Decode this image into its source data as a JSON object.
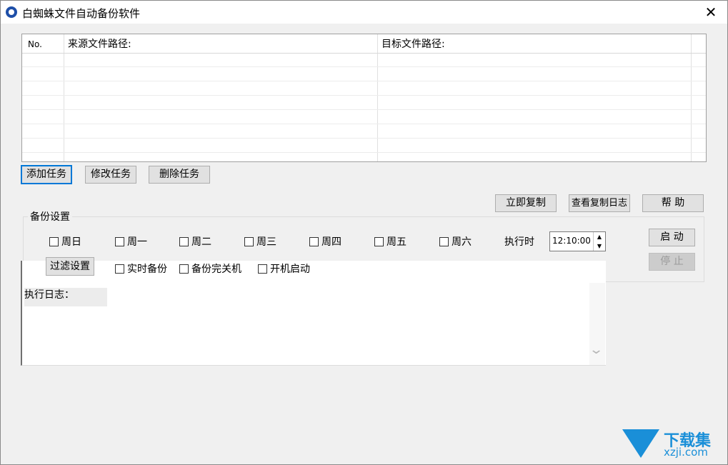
{
  "window": {
    "title": "白蜘蛛文件自动备份软件",
    "close": "✕"
  },
  "grid": {
    "columns": [
      "No.",
      "来源文件路径:",
      "目标文件路径:"
    ]
  },
  "task_buttons": {
    "add": "添加任务",
    "edit": "修改任务",
    "delete": "删除任务"
  },
  "action_buttons": {
    "copy_now": "立即复制",
    "view_log": "查看复制日志",
    "help": "帮 助"
  },
  "backup": {
    "title": "备份设置",
    "days": [
      "周日",
      "周一",
      "周二",
      "周三",
      "周四",
      "周五",
      "周六"
    ],
    "exec_time_label": "执行时",
    "exec_time_value": "12:10:00",
    "filter_button": "过滤设置",
    "options": [
      "实时备份",
      "备份完关机",
      "开机启动"
    ],
    "start": "启 动",
    "stop": "停 止"
  },
  "log": {
    "label": "执行日志："
  },
  "watermark": {
    "name": "下载集",
    "domain": "xzji.com"
  }
}
